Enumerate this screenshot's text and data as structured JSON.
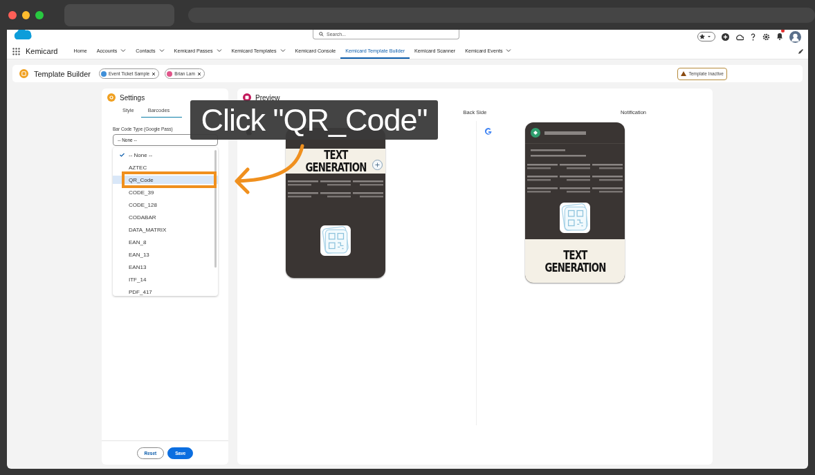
{
  "header": {
    "search_placeholder": "Search...",
    "app_name": "Kemicard",
    "notification_badge": true,
    "nav": [
      {
        "label": "Home",
        "dropdown": false,
        "selected": false
      },
      {
        "label": "Accounts",
        "dropdown": true,
        "selected": false
      },
      {
        "label": "Contacts",
        "dropdown": true,
        "selected": false
      },
      {
        "label": "Kemicard Passes",
        "dropdown": true,
        "selected": false
      },
      {
        "label": "Kemicard Templates",
        "dropdown": true,
        "selected": false
      },
      {
        "label": "Kemicard Console",
        "dropdown": false,
        "selected": false
      },
      {
        "label": "Kemicard Template Builder",
        "dropdown": false,
        "selected": true
      },
      {
        "label": "Kemicard Scanner",
        "dropdown": false,
        "selected": false
      },
      {
        "label": "Kemicard Events",
        "dropdown": true,
        "selected": false
      }
    ]
  },
  "page_header": {
    "title": "Template Builder",
    "chips": [
      {
        "label": "Event Ticket Sample",
        "color": "#3f8fd8"
      },
      {
        "label": "Brian Lam",
        "color": "#e0558a"
      }
    ],
    "status": "Template Inactive"
  },
  "settings": {
    "title": "Settings",
    "tabs": [
      {
        "label": "Style",
        "selected": false
      },
      {
        "label": "Barcodes",
        "selected": true
      }
    ],
    "field_label": "Bar Code Type (Google Pass)",
    "value": "-- None --",
    "options": [
      {
        "label": "-- None --",
        "checked": true,
        "highlighted": false
      },
      {
        "label": "AZTEC",
        "checked": false,
        "highlighted": false
      },
      {
        "label": "QR_Code",
        "checked": false,
        "highlighted": true
      },
      {
        "label": "CODE_39",
        "checked": false,
        "highlighted": false
      },
      {
        "label": "CODE_128",
        "checked": false,
        "highlighted": false
      },
      {
        "label": "CODABAR",
        "checked": false,
        "highlighted": false
      },
      {
        "label": "DATA_MATRIX",
        "checked": false,
        "highlighted": false
      },
      {
        "label": "EAN_8",
        "checked": false,
        "highlighted": false
      },
      {
        "label": "EAN_13",
        "checked": false,
        "highlighted": false
      },
      {
        "label": "EAN13",
        "checked": false,
        "highlighted": false
      },
      {
        "label": "ITF_14",
        "checked": false,
        "highlighted": false
      },
      {
        "label": "PDF_417",
        "checked": false,
        "highlighted": false
      }
    ],
    "buttons": [
      {
        "label": "Reset",
        "kind": "outline"
      },
      {
        "label": "Save",
        "kind": "brand"
      }
    ]
  },
  "preview": {
    "title": "Preview",
    "tabs": [
      {
        "label": "Back Side",
        "selected": false
      },
      {
        "label": "Notification",
        "selected": false
      }
    ],
    "apple_pass": {
      "title_lines": [
        "TEXT",
        "GENERATION"
      ]
    },
    "google_pass": {
      "title_lines": [
        "TEXT",
        "GENERATION"
      ]
    }
  },
  "callout": {
    "text": "Click \"QR_Code\""
  }
}
